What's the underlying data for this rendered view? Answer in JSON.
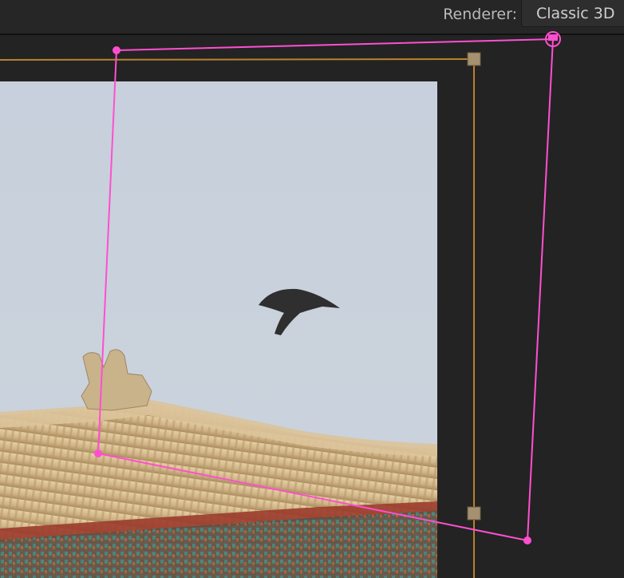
{
  "toolbar": {
    "renderer_label": "Renderer:",
    "renderer_value": "Classic 3D"
  },
  "colors": {
    "panel_bg": "#232323",
    "layer_handle_color": "#b8832e",
    "mask_path_color": "#ff4fd0",
    "sky": "#c8d1dd"
  },
  "icons": {
    "handles": "square-handle-icon",
    "vertices": "mask-vertex-icon",
    "target": "null-target-icon"
  }
}
